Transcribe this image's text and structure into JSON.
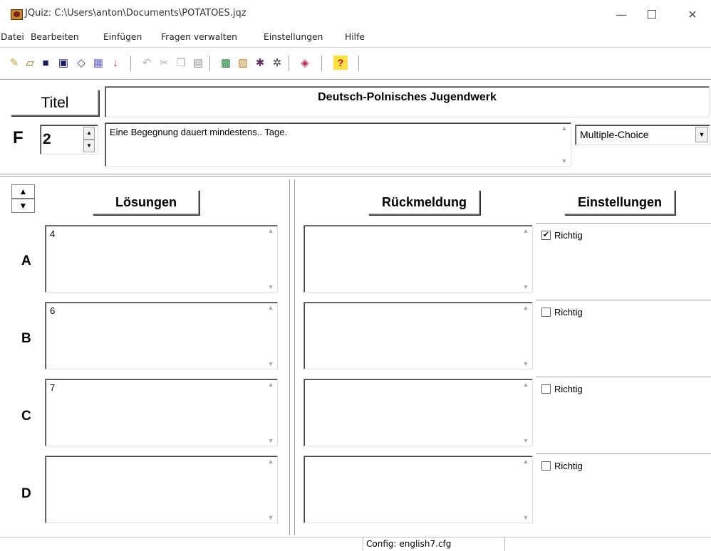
{
  "window": {
    "title": "JQuiz: C:\\Users\\anton\\Documents\\POTATOES.jqz",
    "minimize": "—",
    "close": "✕"
  },
  "menu": [
    "Datei",
    "Bearbeiten",
    "Einfügen",
    "Fragen verwalten",
    "Einstellungen",
    "Hilfe"
  ],
  "toolbar": {
    "icons": [
      "new-icon",
      "open-icon",
      "save-icon",
      "save-as-icon",
      "eraser-icon",
      "add-image-icon",
      "insert-arrow-icon",
      "undo-icon",
      "cut-icon",
      "copy-icon",
      "paste-icon",
      "export-web-icon",
      "export-hotpot-icon",
      "export-settings-icon",
      "export-special-icon",
      "config-icon",
      "help-icon"
    ],
    "help_glyph": "?"
  },
  "title_section": {
    "label": "Titel",
    "value": "Deutsch-Polnisches Jugendwerk"
  },
  "question": {
    "label": "F",
    "number": "2",
    "text": "Eine Begegnung dauert mindestens.. Tage.",
    "type": "Multiple-Choice"
  },
  "headers": {
    "answers": "Lösungen",
    "feedback": "Rückmeldung",
    "settings": "Einstellungen"
  },
  "answers": [
    {
      "letter": "A",
      "text": "4",
      "feedback": "",
      "correct_label": "Richtig",
      "correct": true
    },
    {
      "letter": "B",
      "text": "6",
      "feedback": "",
      "correct_label": "Richtig",
      "correct": false
    },
    {
      "letter": "C",
      "text": "7",
      "feedback": "",
      "correct_label": "Richtig",
      "correct": false
    },
    {
      "letter": "D",
      "text": "",
      "feedback": "",
      "correct_label": "Richtig",
      "correct": false
    }
  ],
  "status": {
    "config": "Config: english7.cfg"
  },
  "colors": {
    "background": "#ffffff",
    "border_dark": "#808080",
    "help_icon": "#e0b000"
  }
}
